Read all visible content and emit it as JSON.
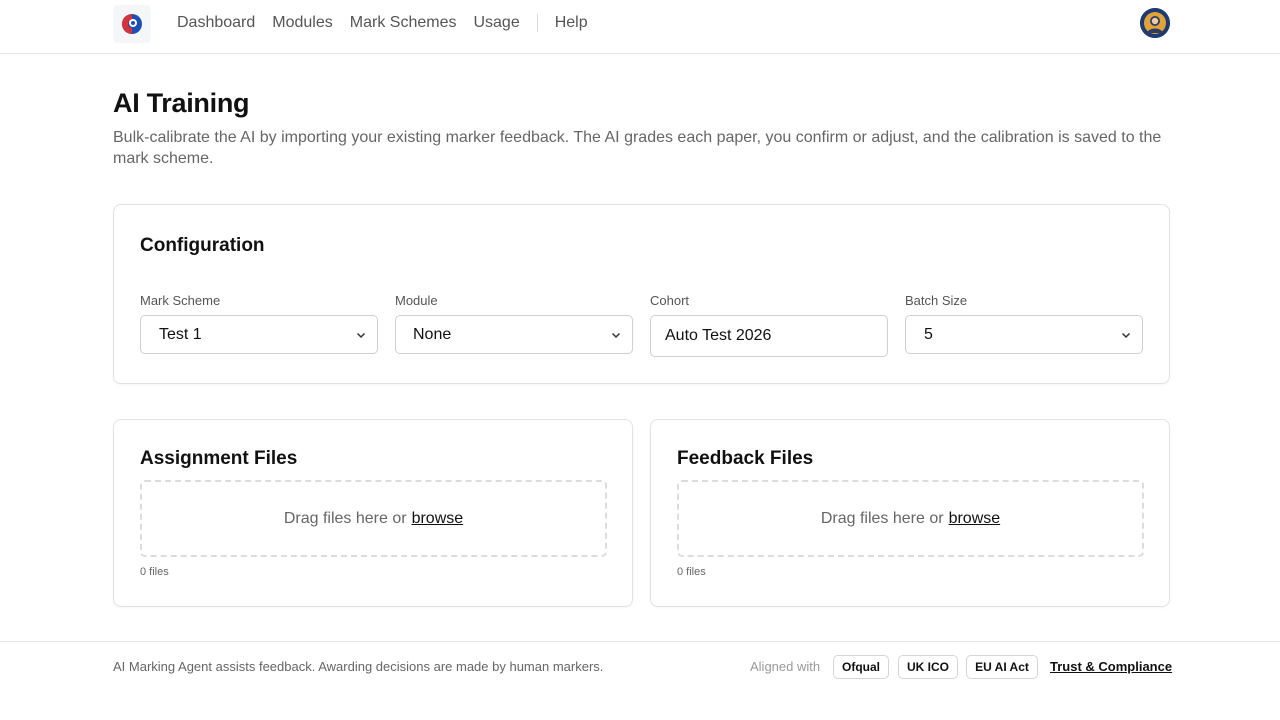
{
  "nav": {
    "logo_icon": "app-logo-icon",
    "items": [
      {
        "label": "Dashboard"
      },
      {
        "label": "Modules"
      },
      {
        "label": "Mark Schemes"
      },
      {
        "label": "Usage"
      }
    ],
    "help_label": "Help",
    "avatar_icon": "user-avatar-icon"
  },
  "page": {
    "title": "AI Training",
    "description": "Bulk-calibrate the AI by importing your existing marker feedback. The AI grades each paper, you confirm or adjust, and the calibration is saved to the mark scheme."
  },
  "config": {
    "title": "Configuration",
    "mark_scheme": {
      "label": "Mark Scheme",
      "value": "Test 1"
    },
    "module": {
      "label": "Module",
      "value": "None"
    },
    "cohort": {
      "label": "Cohort",
      "value": "Auto Test 2026"
    },
    "batch_size": {
      "label": "Batch Size",
      "value": "5"
    }
  },
  "assignment_files": {
    "title": "Assignment Files",
    "drop_text": "Drag files here or",
    "browse_label": "browse",
    "count": "0 files"
  },
  "feedback_files": {
    "title": "Feedback Files",
    "drop_text": "Drag files here or",
    "browse_label": "browse",
    "count": "0 files"
  },
  "footer": {
    "note": "AI Marking Agent assists feedback. Awarding decisions are made by human markers.",
    "aligned_label": "Aligned with",
    "badges": [
      "Ofqual",
      "UK ICO",
      "EU AI Act"
    ],
    "trust_link": "Trust & Compliance"
  },
  "colors": {
    "accent_blue": "#1e4db7",
    "accent_red": "#d3343b",
    "text": "#111111",
    "muted": "#666666",
    "border": "#e2e2e2"
  }
}
